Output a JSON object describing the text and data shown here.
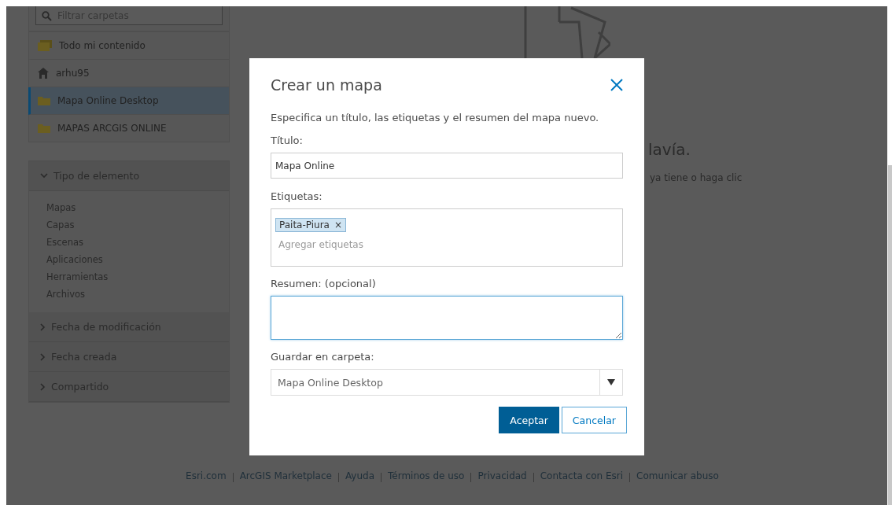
{
  "sidebar": {
    "search": {
      "placeholder": "Filtrar carpetas"
    },
    "folders": [
      {
        "label": "Todo mi contenido",
        "kind": "all",
        "selected": false
      },
      {
        "label": "arhu95",
        "kind": "home",
        "selected": false
      },
      {
        "label": "Mapa Online Desktop",
        "kind": "folder",
        "selected": true
      },
      {
        "label": "MAPAS ARCGIS ONLINE",
        "kind": "folder",
        "selected": false
      }
    ],
    "filters": [
      {
        "label": "Tipo de elemento",
        "expanded": true,
        "options": [
          "Mapas",
          "Capas",
          "Escenas",
          "Aplicaciones",
          "Herramientas",
          "Archivos"
        ]
      },
      {
        "label": "Fecha de modificación",
        "expanded": false
      },
      {
        "label": "Fecha creada",
        "expanded": false
      },
      {
        "label": "Compartido",
        "expanded": false
      }
    ]
  },
  "content": {
    "heading": "lavía.",
    "text": "ya tiene o haga clic"
  },
  "dialog": {
    "title": "Crear un mapa",
    "intro": "Especifica un título, las etiquetas y el resumen del mapa nuevo.",
    "title_field": {
      "label": "Título:",
      "value": "Mapa Online"
    },
    "tags_field": {
      "label": "Etiquetas:",
      "tags": [
        {
          "text": "Paita-Piura",
          "remove": "×"
        }
      ],
      "placeholder": "Agregar etiquetas"
    },
    "summary_field": {
      "label": "Resumen: (opcional)",
      "focused": true
    },
    "folder_field": {
      "label": "Guardar en carpeta:",
      "value": "Mapa Online Desktop"
    },
    "buttons": [
      {
        "label": "Aceptar",
        "kind": "primary"
      },
      {
        "label": "Cancelar",
        "kind": "secondary"
      }
    ]
  },
  "footer": {
    "links": [
      "Esri.com",
      "ArcGIS Marketplace",
      "Ayuda",
      "Términos de uso",
      "Privacidad",
      "Contacta con Esri",
      "Comunicar abuso"
    ]
  }
}
